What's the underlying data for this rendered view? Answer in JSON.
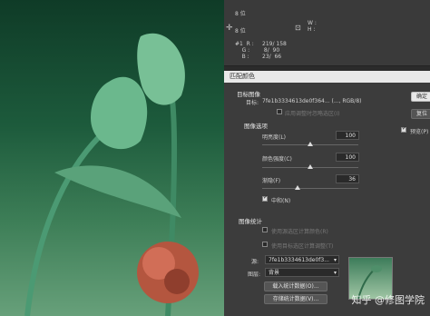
{
  "info": {
    "r1c1": "8 位",
    "r1c2": "C :\nM :\nY :\nK :",
    "r2c1": "8 位",
    "xy": "X :\nY :",
    "rgb1": "#1  R :\n    G :\n    B :",
    "rgb1v": "219/ 158\n 8/  90\n23/  66",
    "wh": "W :\nH :"
  },
  "dialog": {
    "title": "匹配颜色",
    "target_header": "目标图像",
    "target_label": "目标:",
    "target_value": "7fe1b3334613de0f364... (..., RGB/8)",
    "ignore_selection": "应用调整时忽略选区(I)",
    "options_header": "图像选项",
    "luminance_label": "明亮度(L)",
    "luminance_value": "100",
    "color_intensity_label": "颜色强度(C)",
    "color_intensity_value": "100",
    "fade_label": "渐隐(F)",
    "fade_value": "36",
    "neutralize_label": "中和(N)",
    "stats_header": "图像统计",
    "use_source_sel": "使用源选区计算颜色(R)",
    "use_target_sel": "使用目标选区计算调整(T)",
    "source_label": "源:",
    "source_value": "7fe1b3334613de0f3...",
    "layer_label": "图层:",
    "layer_value": "背景",
    "load_stats": "载入统计数据(O)...",
    "save_stats": "存储统计数据(V)...",
    "ok": "确定",
    "reset": "复位",
    "preview": "预览(P)"
  },
  "watermark": "知乎 @修图学院"
}
